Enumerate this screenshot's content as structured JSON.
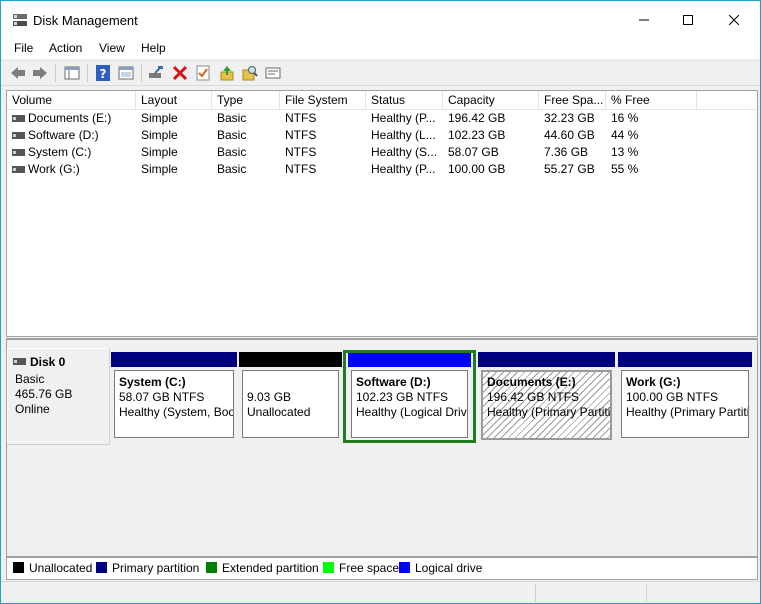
{
  "window": {
    "title": "Disk Management"
  },
  "menu": {
    "items": [
      "File",
      "Action",
      "View",
      "Help"
    ]
  },
  "toolbar": {
    "buttons": [
      "back-icon",
      "forward-icon",
      "console-tree-icon",
      "help-icon",
      "properties-icon",
      "connect-icon",
      "delete-icon",
      "check-icon",
      "export-icon",
      "find-icon",
      "view-icon"
    ]
  },
  "volume_list": {
    "columns": [
      "Volume",
      "Layout",
      "Type",
      "File System",
      "Status",
      "Capacity",
      "Free Spa...",
      "% Free"
    ],
    "rows": [
      {
        "volume": "Documents (E:)",
        "layout": "Simple",
        "type": "Basic",
        "fs": "NTFS",
        "status": "Healthy (P...",
        "capacity": "196.42 GB",
        "free": "32.23 GB",
        "pct": "16 %"
      },
      {
        "volume": "Software (D:)",
        "layout": "Simple",
        "type": "Basic",
        "fs": "NTFS",
        "status": "Healthy (L...",
        "capacity": "102.23 GB",
        "free": "44.60 GB",
        "pct": "44 %"
      },
      {
        "volume": "System (C:)",
        "layout": "Simple",
        "type": "Basic",
        "fs": "NTFS",
        "status": "Healthy (S...",
        "capacity": "58.07 GB",
        "free": "7.36 GB",
        "pct": "13 %"
      },
      {
        "volume": "Work (G:)",
        "layout": "Simple",
        "type": "Basic",
        "fs": "NTFS",
        "status": "Healthy (P...",
        "capacity": "100.00 GB",
        "free": "55.27 GB",
        "pct": "55 %"
      }
    ]
  },
  "disk": {
    "name": "Disk 0",
    "type": "Basic",
    "size": "465.76 GB",
    "state": "Online",
    "partitions": [
      {
        "name": "System  (C:)",
        "size": "58.07 GB NTFS",
        "status": "Healthy (System, Boo",
        "kind": "primary"
      },
      {
        "name": "",
        "size": "9.03 GB",
        "status": "Unallocated",
        "kind": "unallocated"
      },
      {
        "name": "Software  (D:)",
        "size": "102.23 GB NTFS",
        "status": "Healthy (Logical Driv",
        "kind": "logical",
        "selected": true
      },
      {
        "name": "Documents  (E:)",
        "size": "196.42 GB NTFS",
        "status": "Healthy (Primary Partitio",
        "kind": "primary",
        "hatched": true
      },
      {
        "name": "Work  (G:)",
        "size": "100.00 GB NTFS",
        "status": "Healthy (Primary Partiti",
        "kind": "primary"
      }
    ]
  },
  "legend": {
    "items": [
      {
        "label": "Unallocated",
        "color": "#000000"
      },
      {
        "label": "Primary partition",
        "color": "#000080"
      },
      {
        "label": "Extended partition",
        "color": "#007f00"
      },
      {
        "label": "Free space",
        "color": "#00ff00"
      },
      {
        "label": "Logical drive",
        "color": "#0000ff"
      }
    ]
  },
  "colors": {
    "primary_bar": "#000080",
    "unallocated_bar": "#000000",
    "logical_bar": "#0000ff",
    "selection": "#1f7d1f",
    "window_border": "#1ba2c7"
  }
}
